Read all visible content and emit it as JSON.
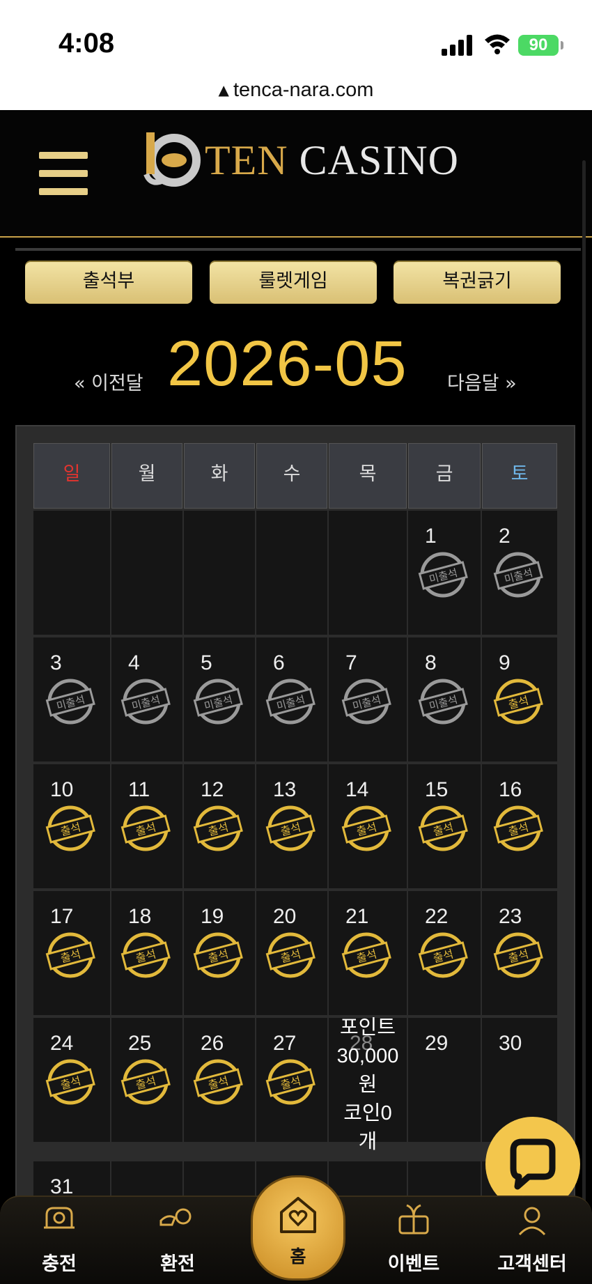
{
  "status_bar": {
    "time": "4:08",
    "battery": "90"
  },
  "browser": {
    "url": "tenca-nara.com"
  },
  "header": {
    "logo_ten": "TEN",
    "logo_casino": "CASINO"
  },
  "top_buttons": [
    "출석부",
    "룰렛게임",
    "복권긁기"
  ],
  "month_nav": {
    "prev_label": "« 이전달",
    "current": "2026-05",
    "next_label": "다음달 »"
  },
  "calendar": {
    "weekdays": [
      "일",
      "월",
      "화",
      "수",
      "목",
      "금",
      "토"
    ],
    "weekday_colors": {
      "sun": "#e3342f",
      "sat": "#6fb7ea"
    },
    "stamp_absent_label": "미출석",
    "stamp_present_label": "출석",
    "days": [
      {
        "day": "1",
        "status": "absent"
      },
      {
        "day": "2",
        "status": "absent"
      },
      {
        "day": "3",
        "status": "absent"
      },
      {
        "day": "4",
        "status": "absent"
      },
      {
        "day": "5",
        "status": "absent"
      },
      {
        "day": "6",
        "status": "absent"
      },
      {
        "day": "7",
        "status": "absent"
      },
      {
        "day": "8",
        "status": "absent"
      },
      {
        "day": "9",
        "status": "present"
      },
      {
        "day": "10",
        "status": "present"
      },
      {
        "day": "11",
        "status": "present"
      },
      {
        "day": "12",
        "status": "present"
      },
      {
        "day": "13",
        "status": "present"
      },
      {
        "day": "14",
        "status": "present"
      },
      {
        "day": "15",
        "status": "present"
      },
      {
        "day": "16",
        "status": "present"
      },
      {
        "day": "17",
        "status": "present"
      },
      {
        "day": "18",
        "status": "present"
      },
      {
        "day": "19",
        "status": "present"
      },
      {
        "day": "20",
        "status": "present"
      },
      {
        "day": "21",
        "status": "present"
      },
      {
        "day": "22",
        "status": "present"
      },
      {
        "day": "23",
        "status": "present"
      },
      {
        "day": "24",
        "status": "present"
      },
      {
        "day": "25",
        "status": "present"
      },
      {
        "day": "26",
        "status": "present"
      },
      {
        "day": "27",
        "status": "present"
      },
      {
        "day": "28",
        "status": "today"
      },
      {
        "day": "29",
        "status": "none"
      },
      {
        "day": "30",
        "status": "none"
      },
      {
        "day": "31",
        "status": "none"
      }
    ],
    "today_note": [
      "포인트",
      "30,000",
      "원",
      "코인0",
      "개"
    ]
  },
  "bottom_nav": {
    "items": [
      {
        "label": "충전",
        "icon": "deposit-icon"
      },
      {
        "label": "환전",
        "icon": "exchange-icon"
      },
      {
        "label": "홈",
        "icon": "home-heart-icon"
      },
      {
        "label": "이벤트",
        "icon": "gift-icon"
      },
      {
        "label": "고객센터",
        "icon": "support-agent-icon"
      }
    ]
  },
  "colors": {
    "gold": "#f2c645",
    "button_gold": "#e9d58e",
    "background": "#000000"
  }
}
